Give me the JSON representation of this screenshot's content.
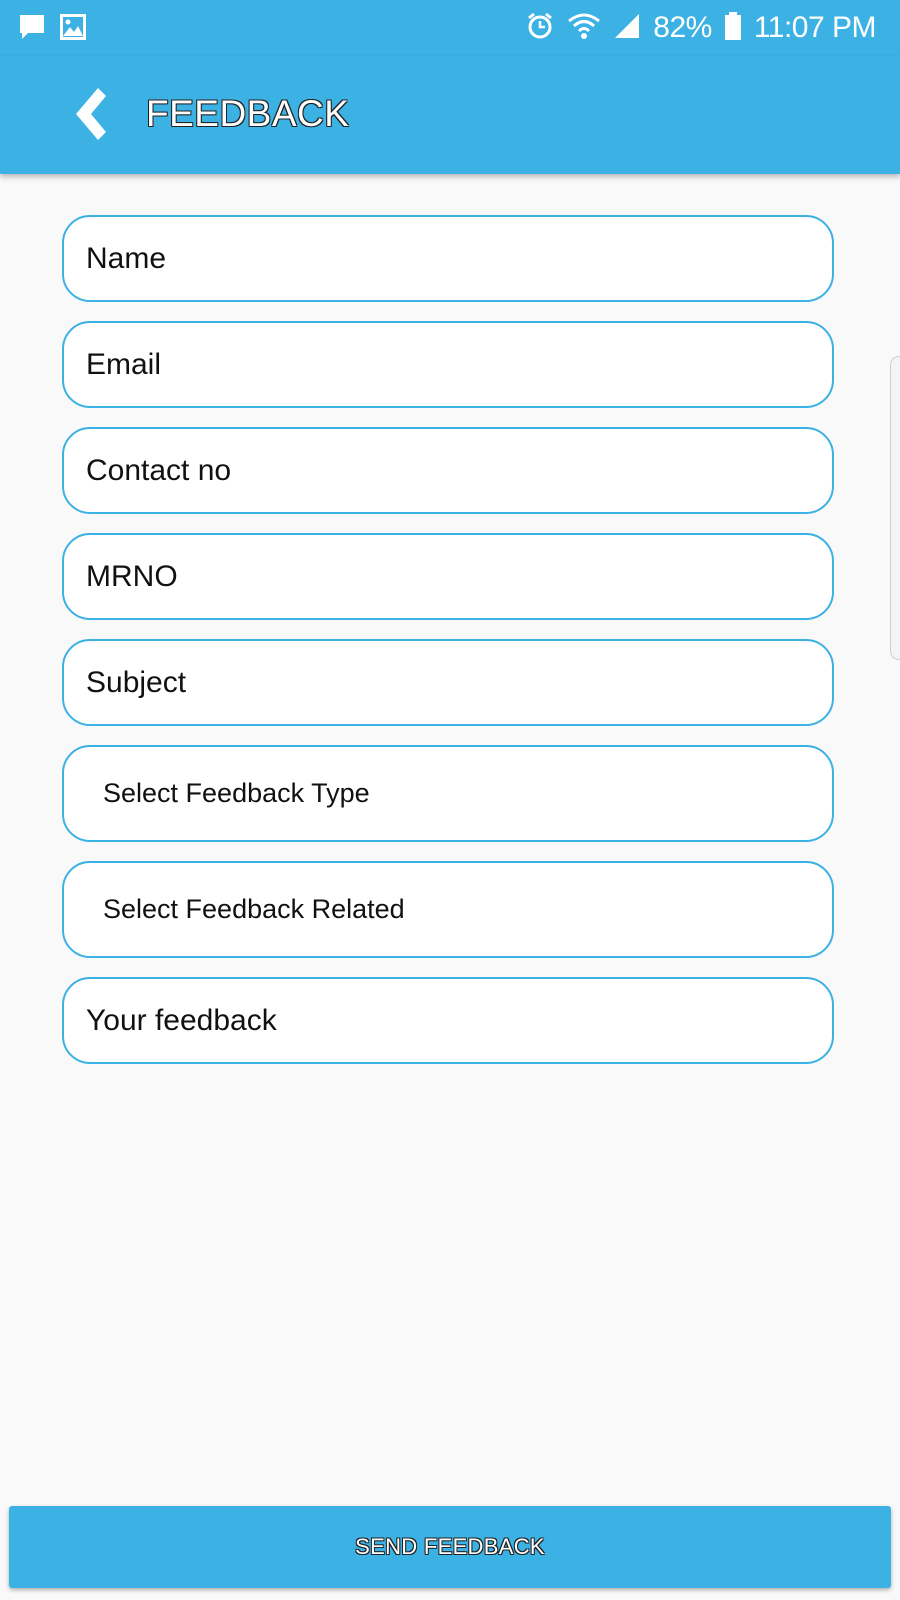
{
  "status_bar": {
    "left_icons": [
      "message-icon",
      "image-icon"
    ],
    "right_icons": [
      "alarm-icon",
      "wifi-icon",
      "signal-icon",
      "battery-icon"
    ],
    "battery": "82%",
    "time": "11:07 PM"
  },
  "app_bar": {
    "title": "FEEDBACK",
    "back_icon": "back-chevron-icon"
  },
  "form": {
    "name_placeholder": "Name",
    "email_placeholder": "Email",
    "contact_placeholder": "Contact no",
    "mrno_placeholder": "MRNO",
    "subject_placeholder": "Subject",
    "feedback_type_select": "Select Feedback Type",
    "feedback_related_select": "Select Feedback Related",
    "feedback_placeholder": "Your feedback"
  },
  "send_button": {
    "label": "SEND FEEDBACK"
  },
  "colors": {
    "primary": "#3bb1e4",
    "background": "#f9f9f9",
    "field_border": "#3bb1e4"
  }
}
